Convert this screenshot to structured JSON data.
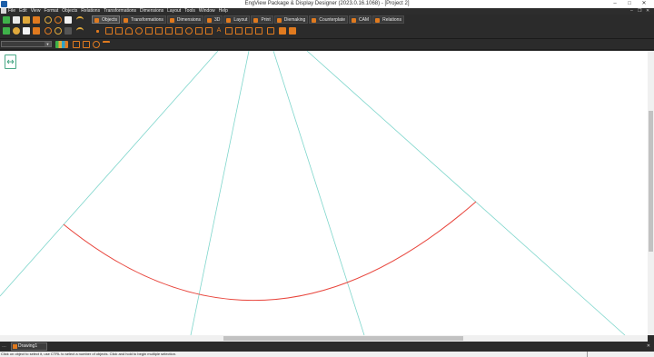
{
  "window": {
    "title": "EngView Package & Display Designer (2023.0.16.1068) - [Project 2]",
    "minimize": "–",
    "maximize": "□",
    "close": "✕"
  },
  "menu": {
    "items": [
      "File",
      "Edit",
      "View",
      "Format",
      "Objects",
      "Relations",
      "Transformations",
      "Dimensions",
      "Layout",
      "Tools",
      "Window",
      "Help"
    ],
    "mdi_minimize": "–",
    "mdi_restore": "❐",
    "mdi_close": "✕"
  },
  "ribbon_tabs": [
    "Objects",
    "Transformations",
    "Dimensions",
    "3D",
    "Layout",
    "Print",
    "Diemaking",
    "Counterplate",
    "CAM",
    "Relations"
  ],
  "document_tabs": {
    "menu_glyph": "…",
    "active": "Drawing1",
    "close_glyph": "✕"
  },
  "status": {
    "message": "Click on object to select it, use CTRL to select a number of objects. Click and hold to begin multiple selection."
  },
  "colors": {
    "guide_line": "#7fd6cc",
    "arc": "#e8453c",
    "accent_orange": "#e07a1f",
    "canvas": "#ffffff"
  },
  "icons": {
    "plugin": "plugin-icon"
  }
}
